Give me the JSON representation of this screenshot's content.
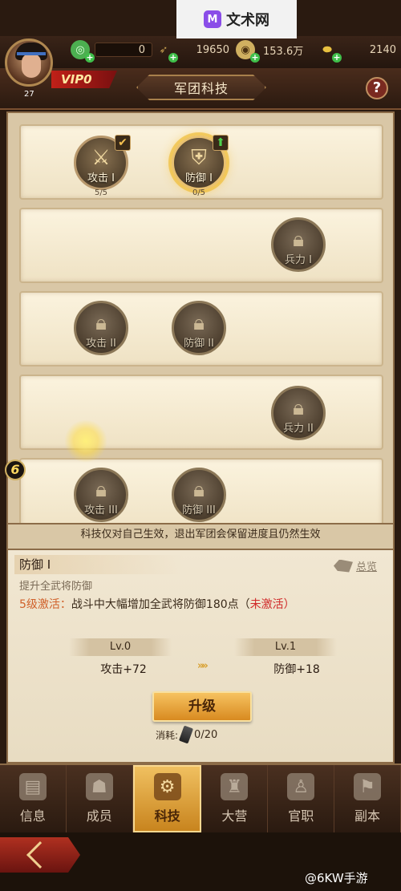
{
  "watermark_top": {
    "logo": "M",
    "text": "文术网"
  },
  "resources": [
    {
      "icon": "jade-coin-icon",
      "value": "0",
      "color": "#4caf50"
    },
    {
      "icon": "arrow-token-icon",
      "value": "19650",
      "color": "#c8a050"
    },
    {
      "icon": "copper-coin-icon",
      "value": "153.6万",
      "color": "#d0b060"
    },
    {
      "icon": "gold-ingot-icon",
      "value": "2140",
      "color": "#e8c040"
    }
  ],
  "player": {
    "level": "27",
    "vip": "VIP0"
  },
  "header": {
    "title": "军团科技",
    "help": "?"
  },
  "tech_rows": [
    {
      "nodes": [
        {
          "label": "攻击 I",
          "progress": "5/5",
          "state": "maxed",
          "glyph": "⚔"
        },
        {
          "label": "防御 I",
          "progress": "0/5",
          "state": "upgradable",
          "glyph": "⛨"
        }
      ]
    },
    {
      "nodes": [
        {
          "label": "兵力 I",
          "state": "locked"
        }
      ]
    },
    {
      "nodes": [
        {
          "label": "攻击 II",
          "state": "locked"
        },
        {
          "label": "防御 II",
          "state": "locked"
        }
      ]
    },
    {
      "nodes": [
        {
          "label": "兵力 II",
          "state": "locked"
        }
      ]
    },
    {
      "nodes": [
        {
          "label": "攻击 III",
          "state": "locked"
        },
        {
          "label": "防御 III",
          "state": "locked"
        }
      ]
    }
  ],
  "side_marker": "6",
  "note": "科技仅对自己生效，退出军团会保留进度且仍然生效",
  "detail": {
    "name": "防御 I",
    "overview": "总览",
    "description": "提升全武将防御",
    "activate_level": "5级激活：",
    "activate_effect": "战斗中大幅增加全武将防御180点（",
    "activate_status": "未激活",
    "activate_close": "）",
    "current": {
      "level": "Lv.0",
      "value": "攻击+72"
    },
    "next": {
      "level": "Lv.1",
      "value": "防御+18"
    },
    "upgrade_label": "升级",
    "cost_label": "消耗:",
    "cost_amount": "0/20"
  },
  "nav_tabs": [
    {
      "label": "信息",
      "icon": "book-icon",
      "glyph": "▤",
      "active": false
    },
    {
      "label": "成员",
      "icon": "members-icon",
      "glyph": "☗",
      "active": false
    },
    {
      "label": "科技",
      "icon": "tech-icon",
      "glyph": "⚙",
      "active": true
    },
    {
      "label": "大营",
      "icon": "camp-icon",
      "glyph": "♜",
      "active": false
    },
    {
      "label": "官职",
      "icon": "official-icon",
      "glyph": "♙",
      "active": false
    },
    {
      "label": "副本",
      "icon": "dungeon-icon",
      "glyph": "⚑",
      "active": false
    }
  ],
  "watermark_bottom": "@6KW手游",
  "colors": {
    "accent_gold": "#f0c060",
    "locked_stroke": "#8c7858",
    "alert_red": "#d02a2a"
  }
}
